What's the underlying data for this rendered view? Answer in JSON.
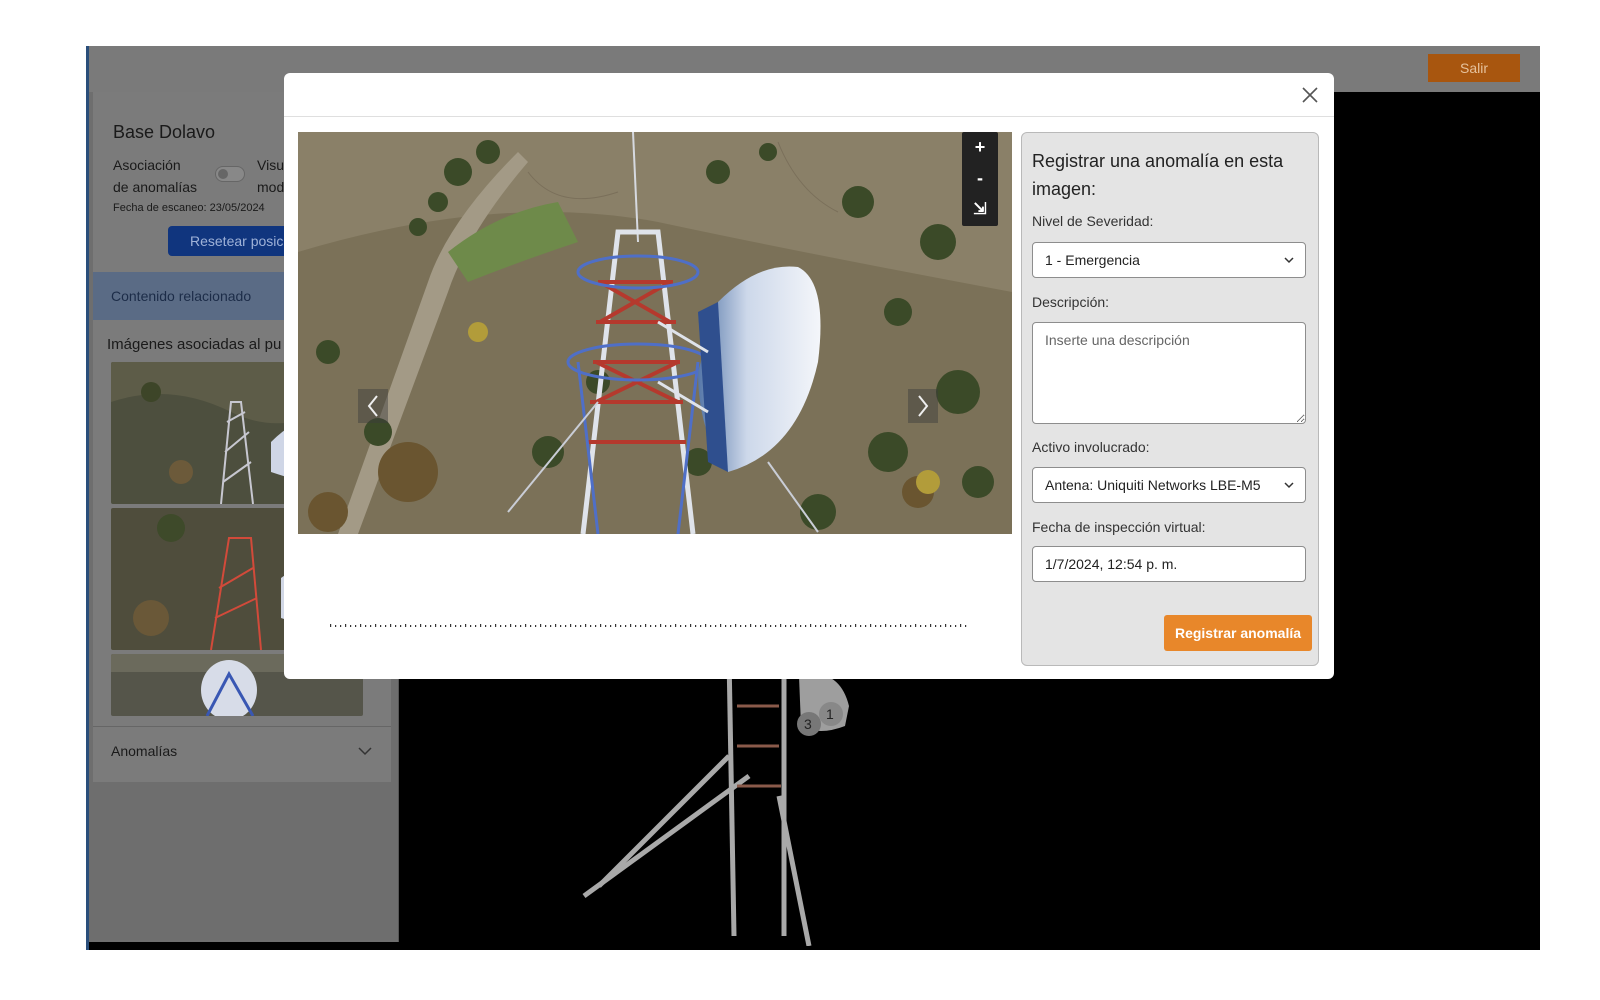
{
  "topbar": {
    "exit_label": "Salir"
  },
  "sidebar": {
    "site_title": "Base Dolavo",
    "assoc_line1": "Asociación",
    "assoc_line2": "de anomalías",
    "visu_line1": "Visu",
    "visu_line2": "mod",
    "scan_date": "Fecha de escaneo: 23/05/2024",
    "reset_label": "Resetear posici",
    "related_label": "Contenido relacionado",
    "images_label": "Imágenes asociadas al pu",
    "anomalies_label": "Anomalías"
  },
  "scene": {
    "marker_1": "1",
    "marker_3": "3"
  },
  "modal": {
    "zoom_in": "+",
    "zoom_out": "-",
    "zoom_reset": "⇲",
    "form": {
      "title": "Registrar una anomalía en esta imagen:",
      "severity_label": "Nivel de Severidad:",
      "severity_value": "1 - Emergencia",
      "description_label": "Descripción:",
      "description_placeholder": "Inserte una descripción",
      "asset_label": "Activo involucrado:",
      "asset_value": "Antena: Uniquiti Networks LBE-M5",
      "date_label": "Fecha de inspección virtual:",
      "date_value": "1/7/2024, 12:54 p. m.",
      "submit_label": "Registrar anomalía"
    }
  },
  "colors": {
    "accent_orange": "#e8872a",
    "exit_button": "#a8560f",
    "reset_button": "#10357e"
  }
}
